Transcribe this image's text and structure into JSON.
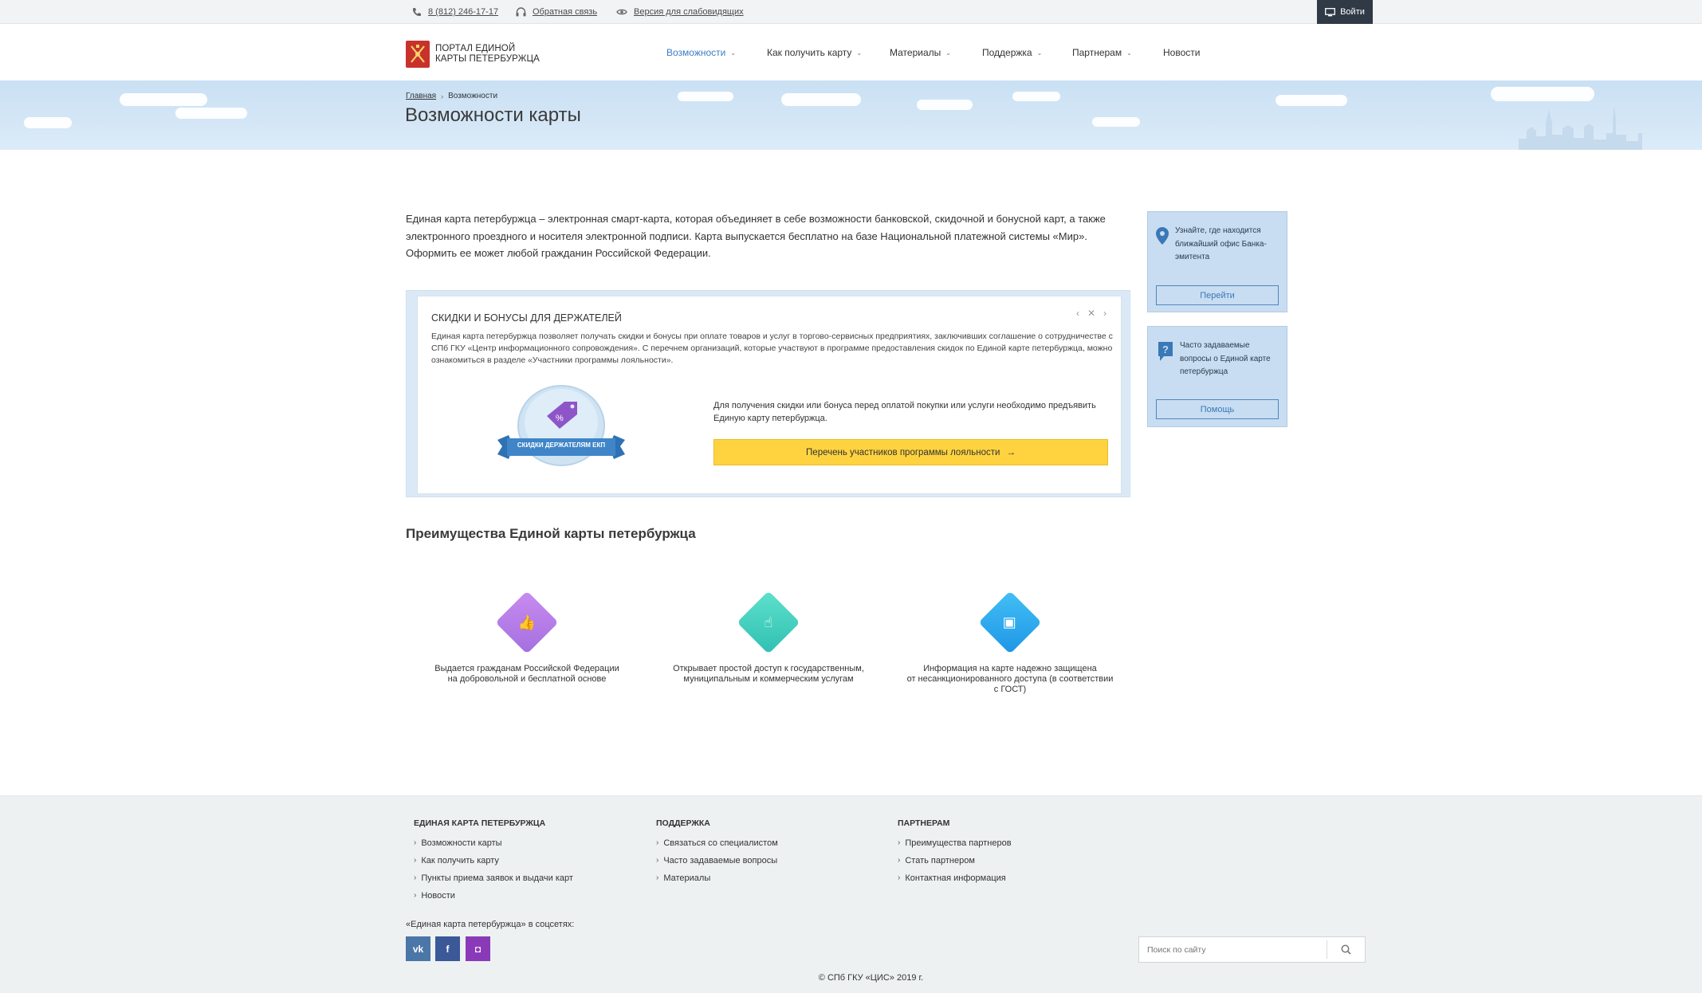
{
  "topbar": {
    "phone": "8 (812) 246-17-17",
    "feedback": "Обратная связь",
    "accessibility": "Версия для слабовидящих",
    "login": "Войти"
  },
  "header": {
    "logo_line1": "ПОРТАЛ ЕДИНОЙ",
    "logo_line2": "КАРТЫ ПЕТЕРБУРЖЦА",
    "nav": [
      {
        "label": "Возможности",
        "active": true
      },
      {
        "label": "Как получить карту"
      },
      {
        "label": "Материалы"
      },
      {
        "label": "Поддержка"
      },
      {
        "label": "Партнерам"
      },
      {
        "label": "Новости"
      }
    ]
  },
  "banner": {
    "breadcrumb_home": "Главная",
    "breadcrumb_current": "Возможности",
    "title": "Возможности карты"
  },
  "intro": "Единая карта петербуржца – электронная смарт-карта, которая объединяет в себе возможности банковской, скидочной и бонусной карт, а также электронного проездного и носителя электронной подписи. Карта выпускается бесплатно на базе Национальной платежной системы «Мир». Оформить ее может любой гражданин Российской Федерации.",
  "promo": {
    "title": "СКИДКИ И БОНУСЫ ДЛЯ ДЕРЖАТЕЛЕЙ",
    "text": "Единая карта петербуржца позволяет получать скидки и бонусы при оплате товаров и услуг в торгово-сервисных предприятиях, заключивших соглашение о сотрудничестве с СПб ГКУ «Центр информационного сопровождения». С перечнем организаций, которые участвуют в программе предоставления скидок по Единой карте петербуржца, можно ознакомиться в разделе «Участники программы лояльности».",
    "badge_label": "СКИДКИ ДЕРЖАТЕЛЯМ ЕКП",
    "note": "Для получения скидки или бонуса перед оплатой покупки или услуги необходимо предъявить Единую карту петербуржца.",
    "button": "Перечень участников программы лояльности"
  },
  "side": {
    "office_text": "Узнайте, где находится ближайший офис Банка-эмитента",
    "office_button": "Перейти",
    "faq_text": "Часто задаваемые вопросы о Единой карте петербуржца",
    "faq_button": "Помощь"
  },
  "advantages": {
    "title": "Преимущества Единой карты петербуржца",
    "items": [
      {
        "line1": "Выдается гражданам Российской Федерации",
        "line2": "на добровольной и бесплатной основе",
        "line3": "",
        "color": "#b77ee6"
      },
      {
        "line1": "Открывает простой доступ к государственным,",
        "line2": "муниципальным и коммерческим услугам",
        "line3": "",
        "color": "#3fcdbf"
      },
      {
        "line1": "Информация на карте надежно защищена",
        "line2": "от несанкционированного доступа (в соответствии",
        "line3": "с ГОСТ)",
        "color": "#2fa7ee"
      }
    ]
  },
  "footer": {
    "col1": {
      "heading": "ЕДИНАЯ КАРТА ПЕТЕРБУРЖЦА",
      "links": [
        "Возможности карты",
        "Как получить карту",
        "Пункты приема заявок и выдачи карт",
        "Новости"
      ]
    },
    "col2": {
      "heading": "ПОДДЕРЖКА",
      "links": [
        "Связаться со специалистом",
        "Часто задаваемые вопросы",
        "Материалы"
      ]
    },
    "col3": {
      "heading": "ПАРТНЕРАМ",
      "links": [
        "Преимущества партнеров",
        "Стать партнером",
        "Контактная информация"
      ]
    },
    "social_label": "«Единая карта петербуржца» в соцсетях:",
    "social": {
      "vk": "vk",
      "fb": "f",
      "ig": "◘"
    },
    "search_placeholder": "Поиск по сайту",
    "copyright": "© СПб ГКУ «ЦИС» 2019 г."
  },
  "colors": {
    "accent": "#3d7cc5",
    "yellow": "#fed33f",
    "dark": "#2f3a46",
    "vk": "#4a76a8",
    "fb": "#3b5998",
    "ig": "#8a3ab9"
  }
}
